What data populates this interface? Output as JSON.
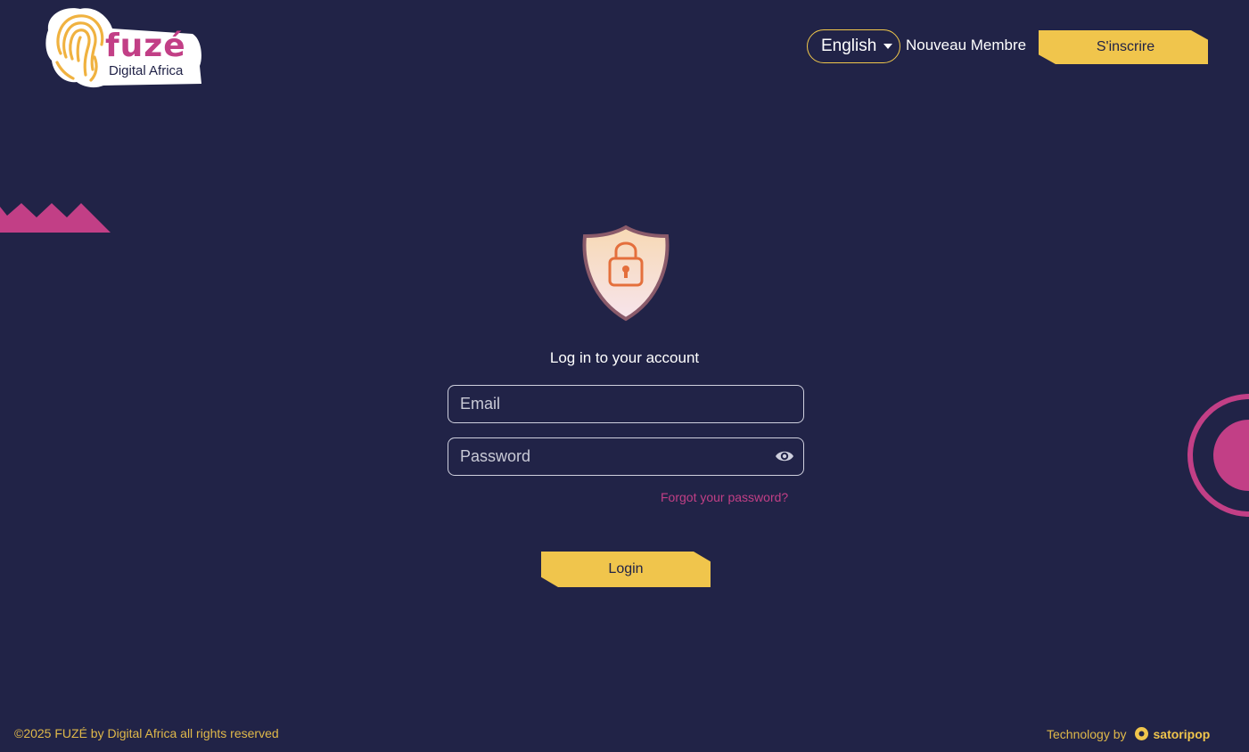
{
  "header": {
    "logo": {
      "name": "fuzé",
      "tagline": "Digital Africa"
    },
    "language": "English",
    "new_member_label": "Nouveau Membre",
    "signup_label": "S'inscrire"
  },
  "login": {
    "title": "Log in to your account",
    "email_placeholder": "Email",
    "password_placeholder": "Password",
    "forgot_label": "Forgot your password?",
    "submit_label": "Login"
  },
  "footer": {
    "copyright": "©2025 FUZÉ by Digital Africa all rights reserved",
    "tech_label": "Technology by",
    "tech_brand": "satoripop"
  },
  "colors": {
    "background": "#212347",
    "accent_yellow": "#f0c54c",
    "accent_pink": "#c23f86"
  },
  "icons": [
    "fingerprint-logo-icon",
    "caret-down-icon",
    "shield-lock-icon",
    "eye-icon",
    "satoripop-logo-icon"
  ]
}
